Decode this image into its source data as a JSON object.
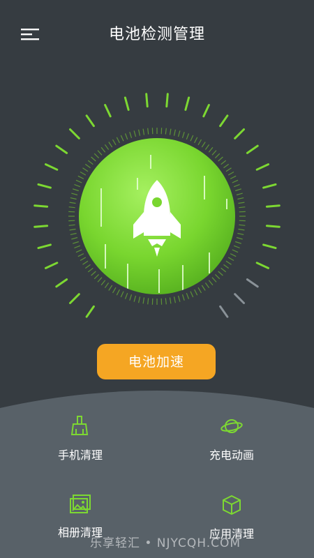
{
  "header": {
    "title": "电池检测管理",
    "menu_icon": "menu-icon"
  },
  "gauge": {
    "center_icon": "rocket-icon",
    "accent_color": "#7dd832",
    "level": 0.88
  },
  "primary_action": {
    "label": "电池加速",
    "color": "#f5a623"
  },
  "features": [
    {
      "label": "手机清理",
      "icon": "broom-icon"
    },
    {
      "label": "充电动画",
      "icon": "planet-icon"
    },
    {
      "label": "相册清理",
      "icon": "photo-icon"
    },
    {
      "label": "应用清理",
      "icon": "box-icon"
    }
  ],
  "watermark": "乐享轻汇 • NJYCQH.COM"
}
